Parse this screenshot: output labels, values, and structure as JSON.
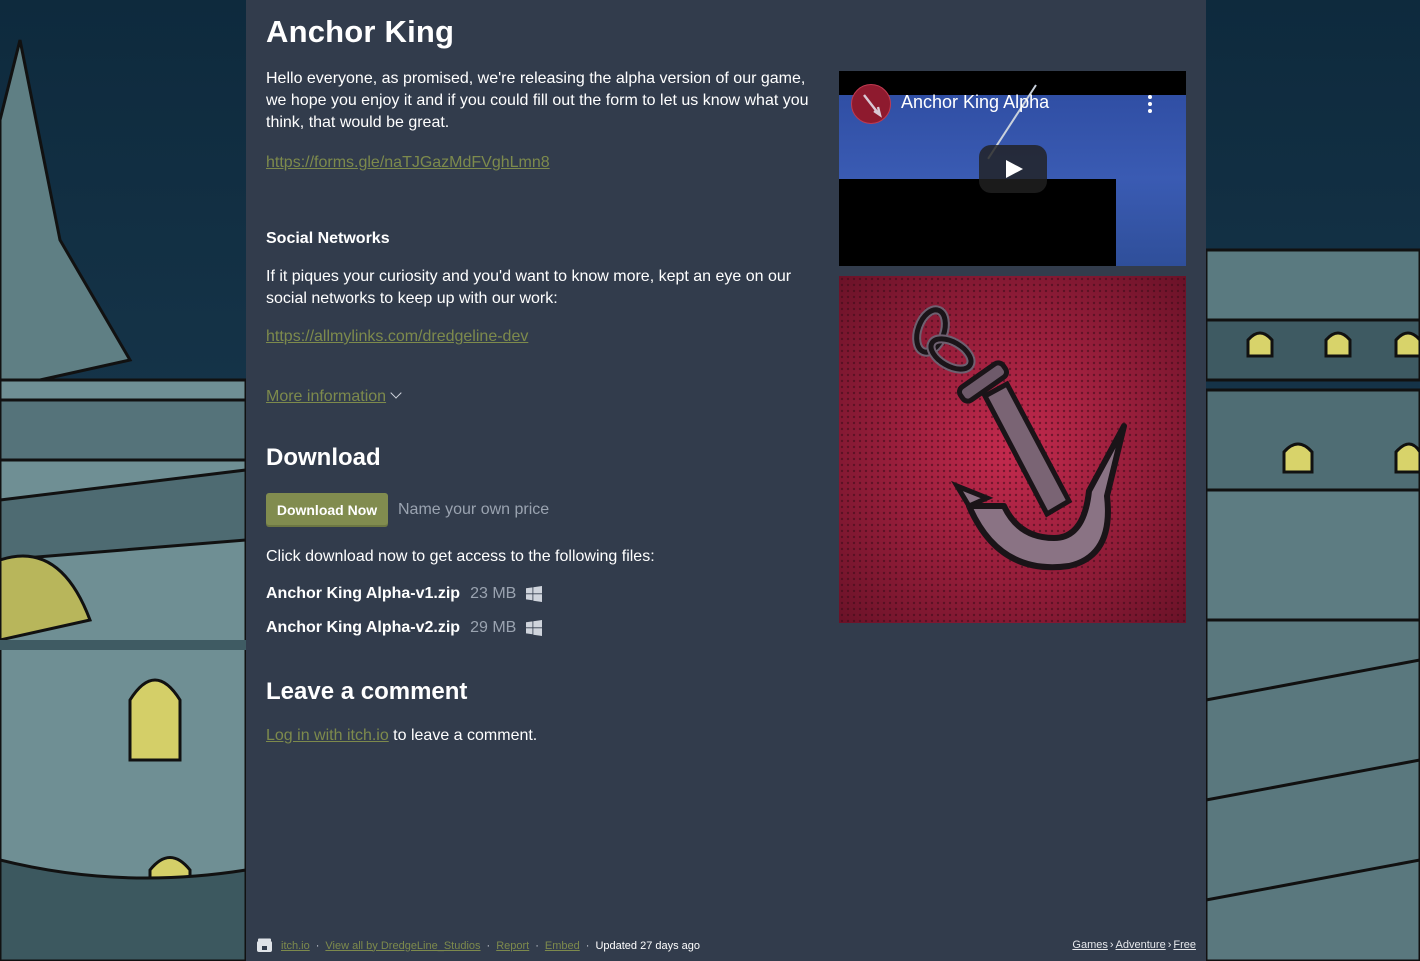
{
  "game": {
    "title": "Anchor King"
  },
  "description": {
    "intro": "Hello everyone, as promised, we're releasing the alpha version of our game, we hope you enjoy it and if you could fill out the form to let us know what you think, that would be great.",
    "form_link": "https://forms.gle/naTJGazMdFVghLmn8",
    "social_heading": "Social Networks",
    "social_text": "If it piques your curiosity and you'd want to know more, kept an eye on our social networks to keep up with our work:",
    "social_link": "https://allmylinks.com/dredgeline-dev",
    "more_info": "More information"
  },
  "download": {
    "heading": "Download",
    "button_label": "Download Now",
    "price_hint": "Name your own price",
    "intro": "Click download now to get access to the following files:",
    "files": [
      {
        "name": "Anchor King Alpha-v1.zip",
        "size": "23 MB",
        "platform_icon": "windows-icon"
      },
      {
        "name": "Anchor King Alpha-v2.zip",
        "size": "29 MB",
        "platform_icon": "windows-icon"
      }
    ]
  },
  "comments": {
    "heading": "Leave a comment",
    "login_link": "Log in with itch.io",
    "login_suffix": " to leave a comment."
  },
  "media": {
    "video_title": "Anchor King Alpha",
    "video_icons": [
      "play-icon",
      "kebab-menu-icon"
    ],
    "artwork": "anchor-artwork"
  },
  "footer": {
    "site": "itch.io",
    "view_all": "View all by DredgeLine_Studios",
    "report": "Report",
    "embed": "Embed",
    "updated": "Updated 27 days ago",
    "breadcrumbs": [
      "Games",
      "Adventure",
      "Free"
    ]
  },
  "colors": {
    "page_bg": "#323c4c",
    "link": "#7d8a4c",
    "button": "#818c4f",
    "text": "#ffffff",
    "muted": "#9aa3b0"
  }
}
